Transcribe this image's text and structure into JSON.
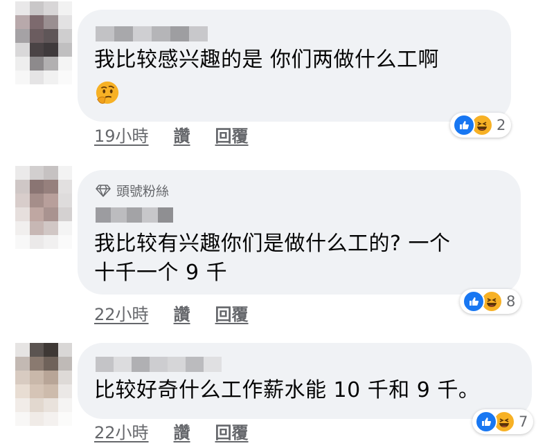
{
  "comments": [
    {
      "text_lines": [
        "我比较感兴趣的是 你们两做什么工啊"
      ],
      "emoji": "thinking-face",
      "badge": null,
      "reactions": {
        "types": [
          "like",
          "haha"
        ],
        "count": "2"
      },
      "actions": {
        "time": "19小時",
        "like": "讚",
        "reply": "回覆"
      }
    },
    {
      "text_lines": [
        "我比较有兴趣你们是做什么工的? 一个",
        "十千一个 9 千"
      ],
      "badge": "頭號粉絲",
      "reactions": {
        "types": [
          "like",
          "haha"
        ],
        "count": "8"
      },
      "actions": {
        "time": "22小時",
        "like": "讚",
        "reply": "回覆"
      }
    },
    {
      "text_lines": [
        "比较好奇什么工作薪水能 10 千和 9 千。"
      ],
      "badge": null,
      "reactions": {
        "types": [
          "like",
          "haha"
        ],
        "count": "7"
      },
      "actions": {
        "time": "22小時",
        "like": "讚",
        "reply": "回覆"
      }
    }
  ],
  "colors": {
    "bubble_bg": "#f0f2f5",
    "muted_text": "#65676b",
    "like_blue": "#1877f2",
    "haha_yellow": "#f7b125"
  }
}
